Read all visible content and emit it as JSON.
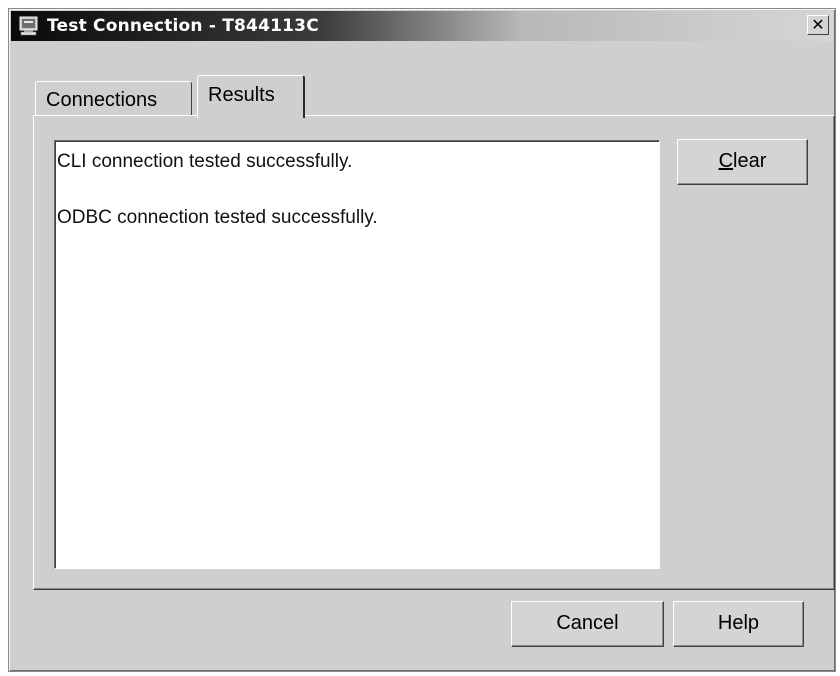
{
  "window": {
    "title": "Test Connection - T844113C",
    "close_glyph": "✕"
  },
  "tabs": [
    {
      "label": "Connections",
      "selected": false
    },
    {
      "label": "Results",
      "selected": true
    }
  ],
  "results": {
    "lines": [
      "CLI connection tested successfully.",
      "ODBC connection tested successfully."
    ]
  },
  "buttons": {
    "clear_mnemonic": "C",
    "clear_rest": "lear",
    "cancel": "Cancel",
    "help": "Help"
  },
  "icons": {
    "app": "computer-window-icon",
    "close": "close-icon"
  }
}
